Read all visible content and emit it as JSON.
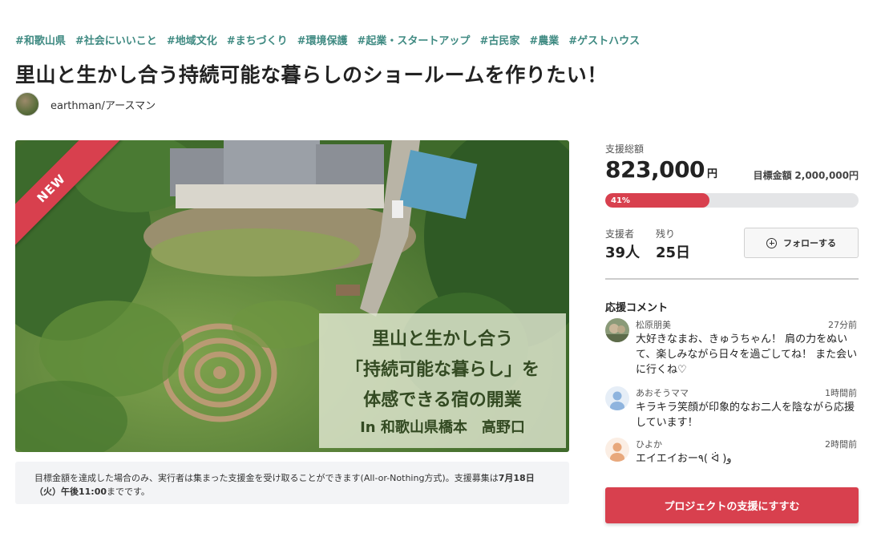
{
  "tags": [
    "#和歌山県",
    "#社会にいいこと",
    "#地域文化",
    "#まちづくり",
    "#環境保護",
    "#起業・スタートアップ",
    "#古民家",
    "#農業",
    "#ゲストハウス"
  ],
  "project": {
    "title": "里山と生かし合う持続可能な暮らしのショールームを作りたい！",
    "owner_name": "earthman/アースマン"
  },
  "hero": {
    "badge": "NEW",
    "overlay_lines": [
      "里山と生かし合う",
      "「持続可能な暮らし」を",
      "体感できる宿の開業",
      "In 和歌山県橋本　高野口"
    ]
  },
  "notice": {
    "text_before": "目標金額を達成した場合のみ、実行者は集まった支援金を受け取ることができます(All-or-Nothing方式)。支援募集は",
    "deadline": "7月18日（火）午後11:00",
    "text_after": "までです。"
  },
  "funding": {
    "total_label": "支援総額",
    "total_amount": "823,000",
    "currency": "円",
    "goal_label": "目標金額",
    "goal_amount": "2,000,000円",
    "progress_percent": 41,
    "progress_label": "41%",
    "backers_label": "支援者",
    "backers_value": "39人",
    "remaining_label": "残り",
    "remaining_value": "25日",
    "follow_label": "フォローする"
  },
  "comments_section": {
    "title": "応援コメント",
    "items": [
      {
        "name": "松原朋美",
        "time": "27分前",
        "text": "大好きなまお、きゅうちゃん！ 肩の力をぬいて、楽しみながら日々を過ごしてね！ また会いに行くね♡"
      },
      {
        "name": "あおそうママ",
        "time": "1時間前",
        "text": "キラキラ笑顔が印象的なお二人を陰ながら応援しています！"
      },
      {
        "name": "ひよか",
        "time": "2時間前",
        "text": "エイエイおー٩( ᐛ )و"
      }
    ]
  },
  "cta": {
    "label": "プロジェクトの支援にすすむ"
  },
  "colors": {
    "accent": "#d8404e",
    "tag": "#3f8a82"
  }
}
